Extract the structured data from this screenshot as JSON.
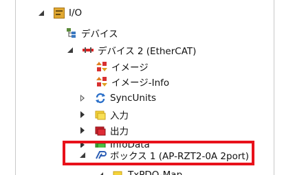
{
  "tree": {
    "io": {
      "label": "I/O",
      "icon": "io-folder-icon"
    },
    "devices": {
      "label": "デバイス",
      "icon": "devices-tree-icon"
    },
    "device2": {
      "label": "デバイス 2 (EtherCAT)",
      "icon": "ethercat-device-icon"
    },
    "image": {
      "label": "イメージ",
      "icon": "image-icon"
    },
    "image_info": {
      "label": "イメージ-Info",
      "icon": "image-info-icon"
    },
    "syncunits": {
      "label": "SyncUnits",
      "icon": "syncunits-icon"
    },
    "input": {
      "label": "入力",
      "icon": "input-folder-icon"
    },
    "output": {
      "label": "出力",
      "icon": "output-folder-icon"
    },
    "infodata": {
      "label": "InfoData",
      "icon": "infodata-icon"
    },
    "box1": {
      "label": "ボックス 1 (AP-RZT2-0A 2port)",
      "icon": "box-icon"
    },
    "txpdo": {
      "label": "TxPDO-Map",
      "icon": "txpdo-map-icon"
    }
  },
  "colors": {
    "highlight": "#e8111a"
  }
}
